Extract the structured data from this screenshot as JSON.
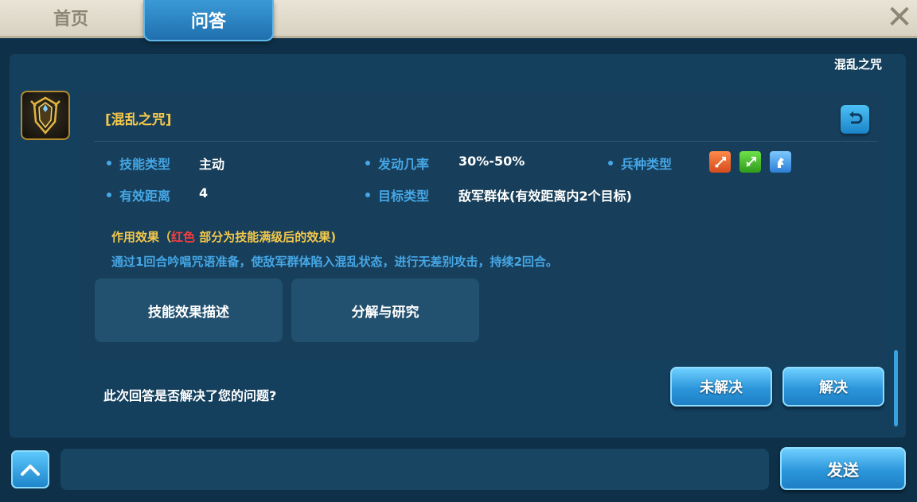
{
  "tabs": {
    "home": "首页",
    "qa": "问答"
  },
  "panel": {
    "header_tag": "混乱之咒"
  },
  "skill": {
    "title": "[混乱之咒]",
    "attrs": {
      "skill_type_label": "技能类型",
      "skill_type_value": "主动",
      "trigger_rate_label": "发动几率",
      "trigger_rate_value": "30%-50%",
      "troop_type_label": "兵种类型",
      "range_label": "有效距离",
      "range_value": "4",
      "target_label": "目标类型",
      "target_value": "敌军群体(有效距离内2个目标)"
    },
    "troop_icons": [
      "archer-icon",
      "spear-icon",
      "cavalry-icon"
    ],
    "effect_title_prefix": "作用效果（",
    "effect_title_red": "红色",
    "effect_title_suffix": " 部分为技能满级后的效果)",
    "effect_desc": "通过1回合吟唱咒语准备，使敌军群体陷入混乱状态，进行无差别攻击，持续2回合。",
    "buttons": {
      "describe": "技能效果描述",
      "research": "分解与研究"
    }
  },
  "feedback": {
    "question": "此次回答是否解决了您的问题?",
    "unresolved": "未解决",
    "resolved": "解决"
  },
  "chat": {
    "send": "发送",
    "input_value": ""
  },
  "colors": {
    "accent_blue": "#46a7e6",
    "gold": "#f3c84b",
    "red": "#ff3b3b"
  }
}
